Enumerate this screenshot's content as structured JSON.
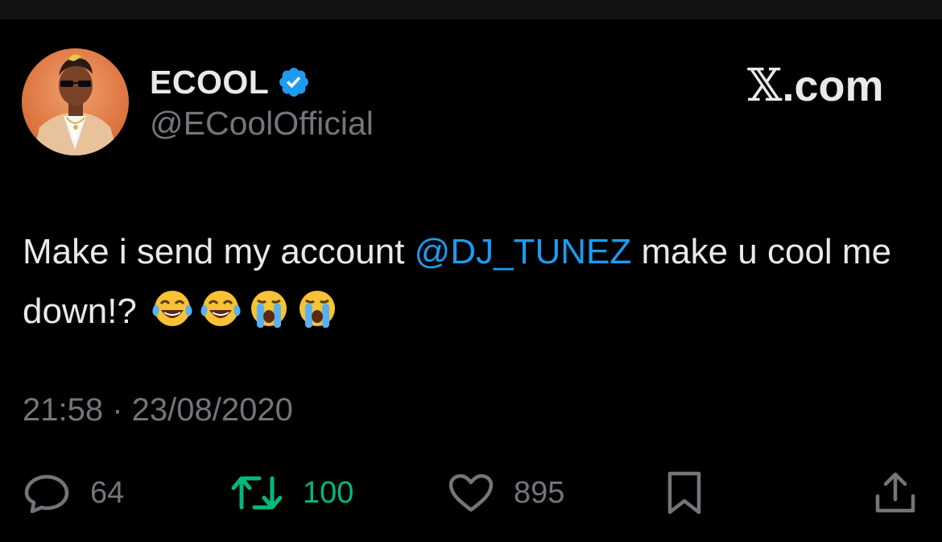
{
  "author": {
    "display_name": "ECOOL",
    "handle": "@ECoolOfficial",
    "verified": true
  },
  "site": {
    "logo_letter": "𝕏",
    "domain_suffix": ".com"
  },
  "tweet": {
    "text_before": "Make i send my account ",
    "mention": "@DJ_TUNEZ",
    "text_after": " make u cool me down!? ",
    "emojis": [
      "face-with-tears-of-joy",
      "face-with-tears-of-joy",
      "loudly-crying-face",
      "loudly-crying-face"
    ],
    "timestamp": "21:58 · 23/08/2020"
  },
  "actions": {
    "replies": "64",
    "retweets": "100",
    "likes": "895"
  },
  "colors": {
    "background": "#000000",
    "text": "#e7e9ea",
    "muted": "#71767b",
    "link": "#1d9bf0",
    "retweet_active": "#00ba7c",
    "verified": "#1d9bf0"
  }
}
